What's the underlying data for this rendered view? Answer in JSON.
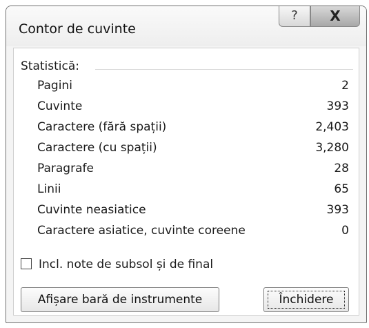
{
  "window": {
    "title": "Contor de cuvinte",
    "help_button": "?",
    "close_button": "X"
  },
  "stats": {
    "header": "Statistică:",
    "rows": [
      {
        "label": "Pagini",
        "value": "2"
      },
      {
        "label": "Cuvinte",
        "value": "393"
      },
      {
        "label": "Caractere (fără spații)",
        "value": "2,403"
      },
      {
        "label": "Caractere (cu spații)",
        "value": "3,280"
      },
      {
        "label": "Paragrafe",
        "value": "28"
      },
      {
        "label": "Linii",
        "value": "65"
      },
      {
        "label": "Cuvinte neasiatice",
        "value": "393"
      },
      {
        "label": "Caractere asiatice, cuvinte coreene",
        "value": "0"
      }
    ]
  },
  "options": {
    "include_notes_label": "Incl. note de subsol și de final",
    "include_notes_checked": false
  },
  "buttons": {
    "show_toolbar": "Afișare bară de instrumente",
    "close": "Închidere"
  }
}
